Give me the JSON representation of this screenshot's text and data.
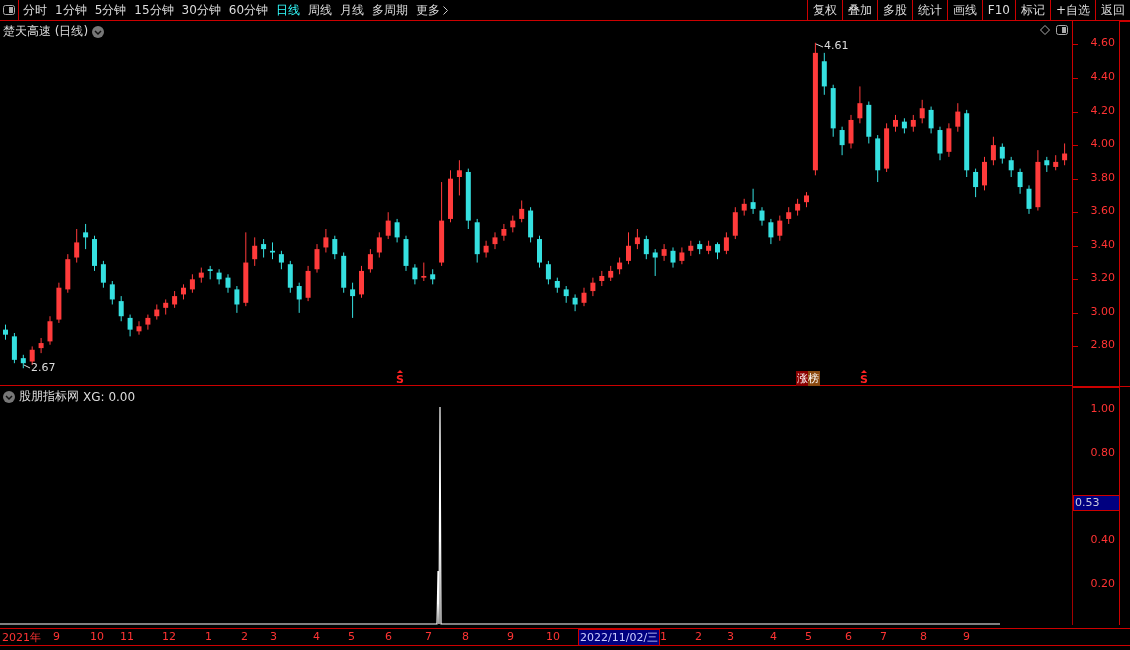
{
  "toolbar": {
    "periods": [
      {
        "label": "分时",
        "selected": false
      },
      {
        "label": "1分钟",
        "selected": false
      },
      {
        "label": "5分钟",
        "selected": false
      },
      {
        "label": "15分钟",
        "selected": false
      },
      {
        "label": "30分钟",
        "selected": false
      },
      {
        "label": "60分钟",
        "selected": false
      },
      {
        "label": "日线",
        "selected": true
      },
      {
        "label": "周线",
        "selected": false
      },
      {
        "label": "月线",
        "selected": false
      },
      {
        "label": "多周期",
        "selected": false
      },
      {
        "label": "更多",
        "selected": false
      }
    ],
    "actions": [
      "复权",
      "叠加",
      "多股",
      "统计",
      "画线",
      "F10",
      "标记",
      "+自选",
      "返回"
    ]
  },
  "main_chart": {
    "title": "楚天高速 (日线)",
    "high_label": "4.61",
    "low_label": "2.67",
    "chart_data": {
      "type": "candlestick",
      "ylim": [
        2.57,
        4.74
      ],
      "yticks": [
        {
          "value": 4.6,
          "label": "4.60"
        },
        {
          "value": 4.4,
          "label": "4.40"
        },
        {
          "value": 4.2,
          "label": "4.20"
        },
        {
          "value": 4.0,
          "label": "4.00"
        },
        {
          "value": 3.8,
          "label": "3.80"
        },
        {
          "value": 3.6,
          "label": "3.60"
        },
        {
          "value": 3.4,
          "label": "3.40"
        },
        {
          "value": 3.2,
          "label": "3.20"
        },
        {
          "value": 3.0,
          "label": "3.00"
        },
        {
          "value": 2.8,
          "label": "2.80"
        }
      ],
      "ohlc": [
        [
          2.9,
          2.93,
          2.84,
          2.87
        ],
        [
          2.86,
          2.88,
          2.7,
          2.72
        ],
        [
          2.73,
          2.75,
          2.67,
          2.7
        ],
        [
          2.71,
          2.8,
          2.69,
          2.78
        ],
        [
          2.79,
          2.85,
          2.76,
          2.82
        ],
        [
          2.83,
          2.98,
          2.81,
          2.95
        ],
        [
          2.96,
          3.18,
          2.94,
          3.15
        ],
        [
          3.14,
          3.35,
          3.12,
          3.32
        ],
        [
          3.33,
          3.5,
          3.3,
          3.42
        ],
        [
          3.48,
          3.53,
          3.38,
          3.45
        ],
        [
          3.44,
          3.46,
          3.25,
          3.28
        ],
        [
          3.29,
          3.31,
          3.15,
          3.18
        ],
        [
          3.17,
          3.19,
          3.05,
          3.08
        ],
        [
          3.07,
          3.1,
          2.95,
          2.98
        ],
        [
          2.97,
          2.99,
          2.86,
          2.9
        ],
        [
          2.89,
          2.95,
          2.87,
          2.92
        ],
        [
          2.93,
          2.99,
          2.9,
          2.97
        ],
        [
          2.98,
          3.05,
          2.96,
          3.02
        ],
        [
          3.03,
          3.08,
          2.99,
          3.06
        ],
        [
          3.05,
          3.13,
          3.03,
          3.1
        ],
        [
          3.11,
          3.17,
          3.08,
          3.15
        ],
        [
          3.14,
          3.23,
          3.12,
          3.2
        ],
        [
          3.21,
          3.27,
          3.18,
          3.24
        ],
        [
          3.26,
          3.28,
          3.2,
          3.25
        ],
        [
          3.24,
          3.26,
          3.17,
          3.2
        ],
        [
          3.21,
          3.23,
          3.12,
          3.15
        ],
        [
          3.14,
          3.16,
          3.0,
          3.05
        ],
        [
          3.06,
          3.48,
          3.04,
          3.3
        ],
        [
          3.32,
          3.45,
          3.28,
          3.4
        ],
        [
          3.41,
          3.44,
          3.33,
          3.38
        ],
        [
          3.37,
          3.42,
          3.32,
          3.36
        ],
        [
          3.35,
          3.37,
          3.26,
          3.3
        ],
        [
          3.29,
          3.31,
          3.12,
          3.15
        ],
        [
          3.16,
          3.18,
          3.0,
          3.08
        ],
        [
          3.09,
          3.28,
          3.07,
          3.25
        ],
        [
          3.26,
          3.41,
          3.24,
          3.38
        ],
        [
          3.39,
          3.5,
          3.36,
          3.45
        ],
        [
          3.44,
          3.46,
          3.32,
          3.35
        ],
        [
          3.34,
          3.36,
          3.12,
          3.15
        ],
        [
          3.14,
          3.18,
          2.97,
          3.1
        ],
        [
          3.11,
          3.28,
          3.09,
          3.25
        ],
        [
          3.26,
          3.38,
          3.24,
          3.35
        ],
        [
          3.36,
          3.48,
          3.33,
          3.45
        ],
        [
          3.46,
          3.6,
          3.44,
          3.55
        ],
        [
          3.54,
          3.56,
          3.42,
          3.45
        ],
        [
          3.44,
          3.46,
          3.25,
          3.28
        ],
        [
          3.27,
          3.29,
          3.17,
          3.2
        ],
        [
          3.21,
          3.3,
          3.19,
          3.22
        ],
        [
          3.23,
          3.26,
          3.17,
          3.2
        ],
        [
          3.3,
          3.78,
          3.28,
          3.55
        ],
        [
          3.56,
          3.85,
          3.54,
          3.8
        ],
        [
          3.81,
          3.91,
          3.7,
          3.85
        ],
        [
          3.84,
          3.86,
          3.5,
          3.55
        ],
        [
          3.54,
          3.56,
          3.3,
          3.35
        ],
        [
          3.36,
          3.43,
          3.33,
          3.4
        ],
        [
          3.41,
          3.48,
          3.38,
          3.45
        ],
        [
          3.46,
          3.53,
          3.43,
          3.5
        ],
        [
          3.51,
          3.58,
          3.48,
          3.55
        ],
        [
          3.56,
          3.67,
          3.54,
          3.62
        ],
        [
          3.61,
          3.63,
          3.42,
          3.45
        ],
        [
          3.44,
          3.46,
          3.27,
          3.3
        ],
        [
          3.29,
          3.31,
          3.17,
          3.2
        ],
        [
          3.19,
          3.21,
          3.12,
          3.15
        ],
        [
          3.14,
          3.16,
          3.06,
          3.1
        ],
        [
          3.09,
          3.11,
          3.01,
          3.05
        ],
        [
          3.06,
          3.15,
          3.04,
          3.12
        ],
        [
          3.13,
          3.21,
          3.1,
          3.18
        ],
        [
          3.19,
          3.25,
          3.16,
          3.22
        ],
        [
          3.21,
          3.28,
          3.19,
          3.25
        ],
        [
          3.26,
          3.33,
          3.23,
          3.3
        ],
        [
          3.31,
          3.48,
          3.29,
          3.4
        ],
        [
          3.41,
          3.5,
          3.38,
          3.45
        ],
        [
          3.44,
          3.46,
          3.32,
          3.35
        ],
        [
          3.36,
          3.38,
          3.22,
          3.33
        ],
        [
          3.34,
          3.41,
          3.31,
          3.38
        ],
        [
          3.37,
          3.39,
          3.27,
          3.3
        ],
        [
          3.31,
          3.39,
          3.29,
          3.36
        ],
        [
          3.37,
          3.43,
          3.34,
          3.4
        ],
        [
          3.41,
          3.43,
          3.35,
          3.38
        ],
        [
          3.37,
          3.43,
          3.35,
          3.4
        ],
        [
          3.41,
          3.42,
          3.32,
          3.36
        ],
        [
          3.37,
          3.48,
          3.35,
          3.45
        ],
        [
          3.46,
          3.63,
          3.44,
          3.6
        ],
        [
          3.61,
          3.68,
          3.58,
          3.65
        ],
        [
          3.66,
          3.74,
          3.59,
          3.62
        ],
        [
          3.61,
          3.63,
          3.52,
          3.55
        ],
        [
          3.54,
          3.56,
          3.41,
          3.45
        ],
        [
          3.46,
          3.58,
          3.43,
          3.55
        ],
        [
          3.56,
          3.63,
          3.53,
          3.6
        ],
        [
          3.61,
          3.68,
          3.58,
          3.65
        ],
        [
          3.66,
          3.72,
          3.63,
          3.7
        ],
        [
          3.85,
          4.61,
          3.82,
          4.55
        ],
        [
          4.5,
          4.55,
          4.3,
          4.35
        ],
        [
          4.34,
          4.36,
          4.05,
          4.1
        ],
        [
          4.09,
          4.11,
          3.94,
          4.0
        ],
        [
          4.01,
          4.18,
          3.98,
          4.15
        ],
        [
          4.16,
          4.35,
          4.13,
          4.25
        ],
        [
          4.24,
          4.26,
          4.01,
          4.05
        ],
        [
          4.04,
          4.06,
          3.78,
          3.85
        ],
        [
          3.86,
          4.13,
          3.84,
          4.1
        ],
        [
          4.11,
          4.18,
          4.08,
          4.15
        ],
        [
          4.14,
          4.16,
          4.07,
          4.1
        ],
        [
          4.11,
          4.18,
          4.08,
          4.15
        ],
        [
          4.16,
          4.27,
          4.13,
          4.22
        ],
        [
          4.21,
          4.23,
          4.07,
          4.1
        ],
        [
          4.09,
          4.11,
          3.91,
          3.95
        ],
        [
          3.96,
          4.13,
          3.93,
          4.1
        ],
        [
          4.11,
          4.25,
          4.08,
          4.2
        ],
        [
          4.19,
          4.21,
          3.81,
          3.85
        ],
        [
          3.84,
          3.86,
          3.69,
          3.75
        ],
        [
          3.76,
          3.93,
          3.73,
          3.9
        ],
        [
          3.91,
          4.05,
          3.88,
          4.0
        ],
        [
          3.99,
          4.01,
          3.89,
          3.92
        ],
        [
          3.91,
          3.93,
          3.81,
          3.85
        ],
        [
          3.84,
          3.86,
          3.71,
          3.75
        ],
        [
          3.74,
          3.76,
          3.59,
          3.62
        ],
        [
          3.63,
          3.97,
          3.61,
          3.9
        ],
        [
          3.91,
          3.93,
          3.84,
          3.88
        ],
        [
          3.87,
          3.94,
          3.85,
          3.9
        ],
        [
          3.91,
          4.01,
          3.88,
          3.95
        ]
      ]
    },
    "markers": [
      {
        "kind": "signal",
        "text": "S"
      },
      {
        "kind": "badge",
        "text": "涨榜"
      },
      {
        "kind": "signal",
        "text": "S"
      }
    ]
  },
  "indicator": {
    "title": "股朋指标网",
    "reading": "XG: 0.00",
    "ticks": [
      "1.00",
      "0.80",
      "0.40",
      "0.20"
    ],
    "cursor_value": "0.53"
  },
  "time_axis": {
    "labels": [
      {
        "label": "2021年",
        "selected": false
      },
      {
        "label": "9",
        "selected": false
      },
      {
        "label": "10",
        "selected": false
      },
      {
        "label": "11",
        "selected": false
      },
      {
        "label": "12",
        "selected": false
      },
      {
        "label": "1",
        "selected": false
      },
      {
        "label": "2",
        "selected": false
      },
      {
        "label": "3",
        "selected": false
      },
      {
        "label": "4",
        "selected": false
      },
      {
        "label": "5",
        "selected": false
      },
      {
        "label": "6",
        "selected": false
      },
      {
        "label": "7",
        "selected": false
      },
      {
        "label": "8",
        "selected": false
      },
      {
        "label": "9",
        "selected": false
      },
      {
        "label": "10",
        "selected": false
      },
      {
        "label": "2022/11/02/三",
        "selected": true
      },
      {
        "label": "1",
        "selected": false
      },
      {
        "label": "2",
        "selected": false
      },
      {
        "label": "3",
        "selected": false
      },
      {
        "label": "4",
        "selected": false
      },
      {
        "label": "5",
        "selected": false
      },
      {
        "label": "6",
        "selected": false
      },
      {
        "label": "7",
        "selected": false
      },
      {
        "label": "8",
        "selected": false
      },
      {
        "label": "9",
        "selected": false
      }
    ]
  }
}
